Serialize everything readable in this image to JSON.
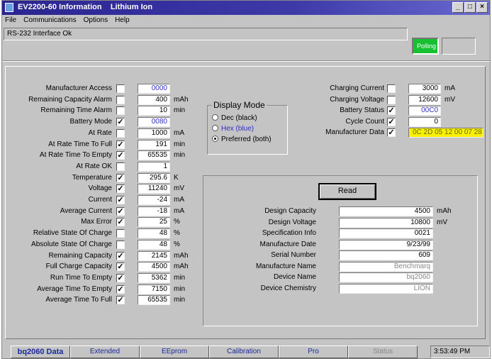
{
  "window": {
    "title": "EV2200-60 Information    Lithium Ion"
  },
  "menu": [
    "File",
    "Communications",
    "Options",
    "Help"
  ],
  "status": {
    "text": "RS-232 Interface Ok",
    "polling": "Polling"
  },
  "left_fields": [
    {
      "label": "Manufacturer Access",
      "checked": false,
      "value": "0000",
      "unit": "",
      "style": "blue"
    },
    {
      "label": "Remaining Capacity Alarm",
      "checked": false,
      "value": "400",
      "unit": "mAh",
      "style": ""
    },
    {
      "label": "Remaining Time Alarm",
      "checked": false,
      "value": "10",
      "unit": "min",
      "style": ""
    },
    {
      "label": "Battery Mode",
      "checked": true,
      "value": "0080",
      "unit": "",
      "style": "blue"
    },
    {
      "label": "At Rate",
      "checked": false,
      "value": "1000",
      "unit": "mA",
      "style": ""
    },
    {
      "label": "At Rate Time To Full",
      "checked": true,
      "value": "191",
      "unit": "min",
      "style": ""
    },
    {
      "label": "At Rate Time To Empty",
      "checked": true,
      "value": "65535",
      "unit": "min",
      "style": ""
    },
    {
      "label": "At Rate OK",
      "checked": false,
      "value": "1",
      "unit": "",
      "style": ""
    },
    {
      "label": "Temperature",
      "checked": true,
      "value": "295.6",
      "unit": "K",
      "style": ""
    },
    {
      "label": "Voltage",
      "checked": true,
      "value": "11240",
      "unit": "mV",
      "style": ""
    },
    {
      "label": "Current",
      "checked": true,
      "value": "-24",
      "unit": "mA",
      "style": ""
    },
    {
      "label": "Average Current",
      "checked": true,
      "value": "-18",
      "unit": "mA",
      "style": ""
    },
    {
      "label": "Max Error",
      "checked": true,
      "value": "25",
      "unit": "%",
      "style": ""
    },
    {
      "label": "Relative State Of Charge",
      "checked": false,
      "value": "48",
      "unit": "%",
      "style": ""
    },
    {
      "label": "Absolute State Of Charge",
      "checked": false,
      "value": "48",
      "unit": "%",
      "style": ""
    },
    {
      "label": "Remaining Capacity",
      "checked": true,
      "value": "2145",
      "unit": "mAh",
      "style": ""
    },
    {
      "label": "Full Charge Capacity",
      "checked": true,
      "value": "4500",
      "unit": "mAh",
      "style": ""
    },
    {
      "label": "Run Time To Empty",
      "checked": true,
      "value": "5362",
      "unit": "min",
      "style": ""
    },
    {
      "label": "Average Time To Empty",
      "checked": true,
      "value": "7150",
      "unit": "min",
      "style": ""
    },
    {
      "label": "Average Time To Full",
      "checked": true,
      "value": "65535",
      "unit": "min",
      "style": ""
    }
  ],
  "display_mode": {
    "title": "Display Mode",
    "options": [
      {
        "label": "Dec (black)",
        "selected": false
      },
      {
        "label": "Hex (blue)",
        "selected": false
      },
      {
        "label": "Preferred (both)",
        "selected": true
      }
    ]
  },
  "right_fields": [
    {
      "label": "Charging Current",
      "checked": false,
      "value": "3000",
      "unit": "mA",
      "style": ""
    },
    {
      "label": "Charging Voltage",
      "checked": false,
      "value": "12600",
      "unit": "mV",
      "style": ""
    },
    {
      "label": "Battery Status",
      "checked": true,
      "value": "00C0",
      "unit": "",
      "style": "blue"
    },
    {
      "label": "Cycle Count",
      "checked": true,
      "value": "0",
      "unit": "",
      "style": ""
    },
    {
      "label": "Manufacturer Data",
      "checked": true,
      "value": "0C 2D 05 12 00 07 28",
      "unit": "",
      "style": "yellow"
    }
  ],
  "read_button": "Read",
  "info_fields": [
    {
      "label": "Design Capacity",
      "value": "4500",
      "unit": "mAh",
      "style": ""
    },
    {
      "label": "Design Voltage",
      "value": "10800",
      "unit": "mV",
      "style": ""
    },
    {
      "label": "Specification Info",
      "value": "0021",
      "unit": "",
      "style": ""
    },
    {
      "label": "Manufacture Date",
      "value": "9/23/99",
      "unit": "",
      "style": ""
    },
    {
      "label": "Serial Number",
      "value": "609",
      "unit": "",
      "style": ""
    },
    {
      "label": "Manufacture Name",
      "value": "Benchmarq",
      "unit": "",
      "style": "gray"
    },
    {
      "label": "Device Name",
      "value": "bq2060",
      "unit": "",
      "style": "gray"
    },
    {
      "label": "Device Chemistry",
      "value": "LION",
      "unit": "",
      "style": "gray"
    }
  ],
  "tabs": [
    {
      "label": "bq2060 Data",
      "active": true,
      "disabled": false
    },
    {
      "label": "Extended",
      "active": false,
      "disabled": false
    },
    {
      "label": "EEprom",
      "active": false,
      "disabled": false
    },
    {
      "label": "Calibration",
      "active": false,
      "disabled": false
    },
    {
      "label": "Pro",
      "active": false,
      "disabled": false
    },
    {
      "label": "Status",
      "active": false,
      "disabled": true
    }
  ],
  "clock": "3:53:49 PM"
}
